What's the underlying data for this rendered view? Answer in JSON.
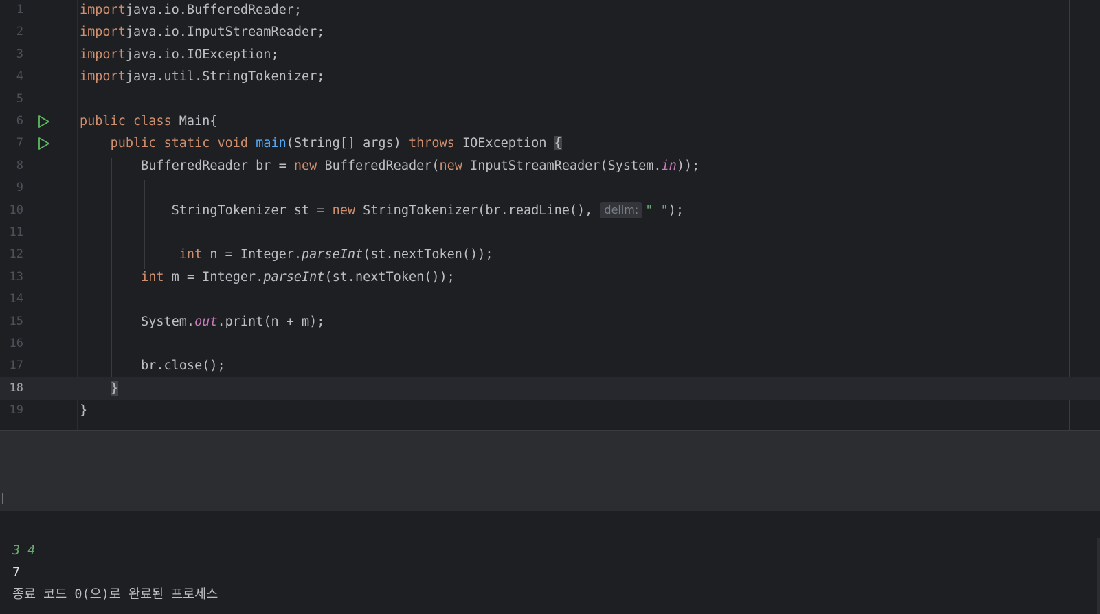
{
  "editor": {
    "lines": [
      {
        "n": "1",
        "parts": [
          [
            "kw",
            "import"
          ],
          [
            "",
            "java.io.BufferedReader;"
          ]
        ]
      },
      {
        "n": "2",
        "parts": [
          [
            "kw",
            "import"
          ],
          [
            "",
            "java.io.InputStreamReader;"
          ]
        ]
      },
      {
        "n": "3",
        "parts": [
          [
            "kw",
            "import"
          ],
          [
            "",
            "java.io.IOException;"
          ]
        ]
      },
      {
        "n": "4",
        "parts": [
          [
            "kw",
            "import"
          ],
          [
            "",
            "java.util.StringTokenizer;"
          ]
        ]
      },
      {
        "n": "5",
        "parts": []
      },
      {
        "n": "6",
        "run": true,
        "parts": [
          [
            "kw",
            "public class "
          ],
          [
            "",
            "Main{"
          ]
        ]
      },
      {
        "n": "7",
        "run": true,
        "parts": [
          [
            "",
            "    "
          ],
          [
            "kw",
            "public static void "
          ],
          [
            "fn",
            "main"
          ],
          [
            "",
            "(String[] args) "
          ],
          [
            "kw",
            "throws "
          ],
          [
            "",
            "IOException "
          ],
          [
            "brace",
            "{"
          ]
        ]
      },
      {
        "n": "8",
        "parts": [
          [
            "",
            "        BufferedReader br = "
          ],
          [
            "kw",
            "new "
          ],
          [
            "",
            "BufferedReader("
          ],
          [
            "kw",
            "new "
          ],
          [
            "",
            "InputStreamReader(System."
          ],
          [
            "st",
            "in"
          ],
          [
            "",
            "));"
          ]
        ]
      },
      {
        "n": "9",
        "parts": []
      },
      {
        "n": "10",
        "parts": [
          [
            "",
            "            StringTokenizer st = "
          ],
          [
            "kw",
            "new "
          ],
          [
            "",
            "StringTokenizer(br.readLine(), "
          ],
          [
            "hint",
            "delim:"
          ],
          [
            "str",
            "\" \""
          ],
          [
            "",
            ");"
          ]
        ]
      },
      {
        "n": "11",
        "parts": []
      },
      {
        "n": "12",
        "parts": [
          [
            "",
            "             "
          ],
          [
            "kw",
            "int "
          ],
          [
            "",
            "n = Integer."
          ],
          [
            "it",
            "parseInt"
          ],
          [
            "",
            "(st.nextToken());"
          ]
        ]
      },
      {
        "n": "13",
        "parts": [
          [
            "",
            "        "
          ],
          [
            "kw",
            "int "
          ],
          [
            "",
            "m = Integer."
          ],
          [
            "it",
            "parseInt"
          ],
          [
            "",
            "(st.nextToken());"
          ]
        ]
      },
      {
        "n": "14",
        "parts": []
      },
      {
        "n": "15",
        "parts": [
          [
            "",
            "        System."
          ],
          [
            "st",
            "out"
          ],
          [
            "",
            ".print(n + m);"
          ]
        ]
      },
      {
        "n": "16",
        "parts": []
      },
      {
        "n": "17",
        "parts": [
          [
            "",
            "        br.close();"
          ]
        ]
      },
      {
        "n": "18",
        "current": true,
        "parts": [
          [
            "",
            "    "
          ],
          [
            "brace",
            "}"
          ]
        ]
      },
      {
        "n": "19",
        "parts": [
          [
            "",
            "}"
          ]
        ]
      }
    ]
  },
  "console": {
    "input_echo": "3 4",
    "output": "7",
    "status": "종료 코드 0(으)로 완료된 프로세스"
  },
  "colors": {
    "keyword": "#cf8e6d",
    "method": "#56a8f5",
    "static_field": "#c77dbb",
    "string": "#6aab73",
    "text": "#bcbec4",
    "run_icon": "#5fb865"
  }
}
